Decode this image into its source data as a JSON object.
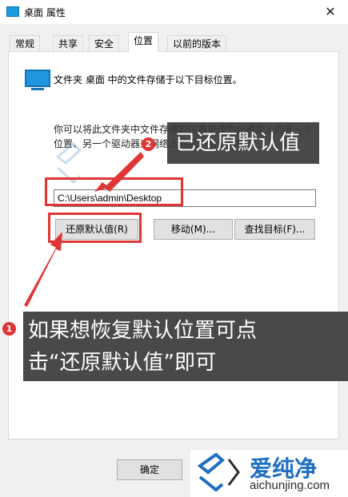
{
  "window": {
    "title": "桌面 属性",
    "close_glyph": "✕"
  },
  "tabs": [
    "常规",
    "共享",
    "安全",
    "位置",
    "以前的版本"
  ],
  "active_tab": "位置",
  "intro_text": "文件夹 桌面 中的文件存储于以下目标位置。",
  "description": "你可以将此文件夹中文件存储的位置更改为此硬盘上的另一个位置、另一个驱动器或网络上的另一台计算机。",
  "path_value": "C:\\Users\\admin\\Desktop",
  "buttons": {
    "restore": "还原默认值(R)",
    "move": "移动(M)...",
    "find": "查找目标(F)..."
  },
  "ok_button": "确定",
  "annotations": {
    "badge1": "1",
    "badge2": "2",
    "callout1": "已还原默认值",
    "callout2_line1": "如果想恢复默认位置可点",
    "callout2_line2": "击“还原默认值”即可"
  },
  "logo": {
    "name": "爱纯净",
    "url": "aichunjing.com"
  },
  "colors": {
    "accent_red": "#e03535",
    "folder_blue": "#1f96de",
    "logo_blue": "#1e6fc2"
  }
}
